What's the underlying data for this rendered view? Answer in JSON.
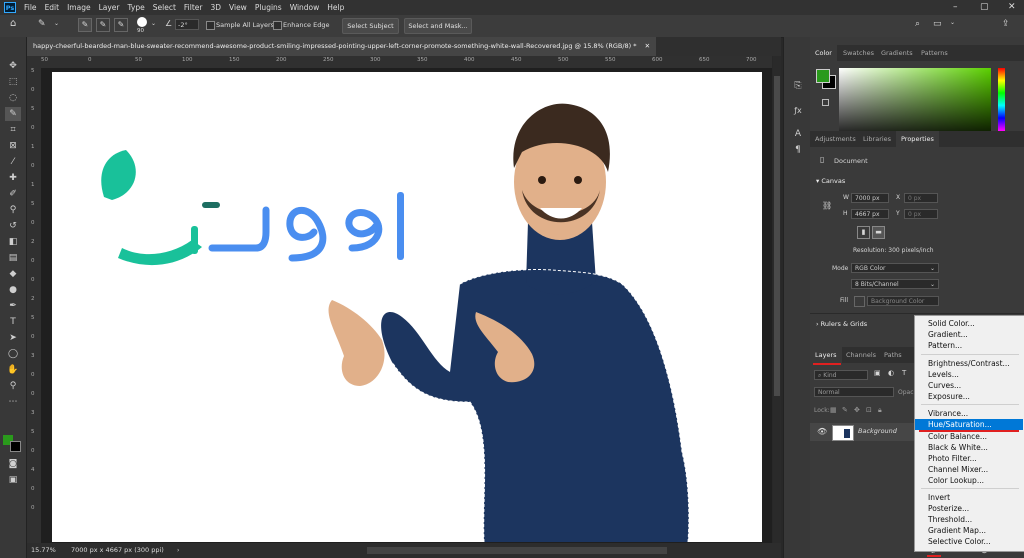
{
  "menubar": {
    "logo": "Ps",
    "items": [
      "File",
      "Edit",
      "Image",
      "Layer",
      "Type",
      "Select",
      "Filter",
      "3D",
      "View",
      "Plugins",
      "Window",
      "Help"
    ]
  },
  "options": {
    "brush_size": "90",
    "angle": "-2°",
    "sample_all_layers": "Sample All Layers",
    "enhance_edge": "Enhance Edge",
    "select_subject": "Select Subject",
    "select_and_mask": "Select and Mask..."
  },
  "document": {
    "tab_title": "happy-cheerful-bearded-man-blue-sweater-recommend-awesome-product-smiling-impressed-pointing-upper-left-corner-promote-something-white-wall-Recovered.jpg @ 15.8% (RGB/8) *",
    "ruler_h": [
      "50",
      "0",
      "50",
      "100",
      "150",
      "200",
      "250",
      "300",
      "350",
      "400",
      "450",
      "500",
      "550",
      "600",
      "650",
      "700"
    ],
    "ruler_v": [
      "5",
      "0",
      "5",
      "0",
      "1",
      "0",
      "1",
      "5",
      "0",
      "2",
      "0",
      "0",
      "2",
      "5",
      "0",
      "3",
      "0",
      "0",
      "3",
      "5",
      "0",
      "4",
      "0",
      "0"
    ],
    "logo_colors": {
      "green": "#19c19a",
      "blue": "#4a8ef0",
      "dark": "#1d6e62"
    }
  },
  "status": {
    "zoom": "15.77%",
    "dimensions": "7000 px x 4667 px (300 ppi)"
  },
  "colors": {
    "foreground": "#2a9a1c",
    "background": "#000000",
    "hue_base": "#5bd000",
    "accent": "#0078d7",
    "annotation_red": "#e02020"
  },
  "color_panel": {
    "tabs": [
      "Color",
      "Swatches",
      "Gradients",
      "Patterns"
    ]
  },
  "properties_panel": {
    "tabs": [
      "Adjustments",
      "Libraries",
      "Properties"
    ],
    "doc_label": "Document",
    "canvas_heading": "Canvas",
    "w_label": "W",
    "w_value": "7000 px",
    "x_label": "X",
    "x_placeholder": "0 px",
    "h_label": "H",
    "h_value": "4667 px",
    "y_label": "Y",
    "y_placeholder": "0 px",
    "resolution": "Resolution: 300 pixels/inch",
    "mode_label": "Mode",
    "mode_value": "RGB Color",
    "bits_value": "8 Bits/Channel",
    "fill_label": "Fill",
    "fill_value": "Background Color",
    "rulers_grids": "Rulers & Grids"
  },
  "layers_panel": {
    "tabs": [
      "Layers",
      "Channels",
      "Paths"
    ],
    "kind_placeholder": "Kind",
    "blend_mode": "Normal",
    "opacity_label": "Opac",
    "lock_label": "Lock:",
    "layer_name": "Background"
  },
  "adjustment_menu": {
    "group1": [
      "Solid Color...",
      "Gradient...",
      "Pattern..."
    ],
    "group2": [
      "Brightness/Contrast...",
      "Levels...",
      "Curves...",
      "Exposure..."
    ],
    "group3": [
      "Vibrance...",
      "Hue/Saturation...",
      "Color Balance...",
      "Black & White...",
      "Photo Filter...",
      "Channel Mixer...",
      "Color Lookup..."
    ],
    "group4": [
      "Invert",
      "Posterize...",
      "Threshold...",
      "Gradient Map...",
      "Selective Color..."
    ],
    "highlighted": "Hue/Saturation..."
  }
}
